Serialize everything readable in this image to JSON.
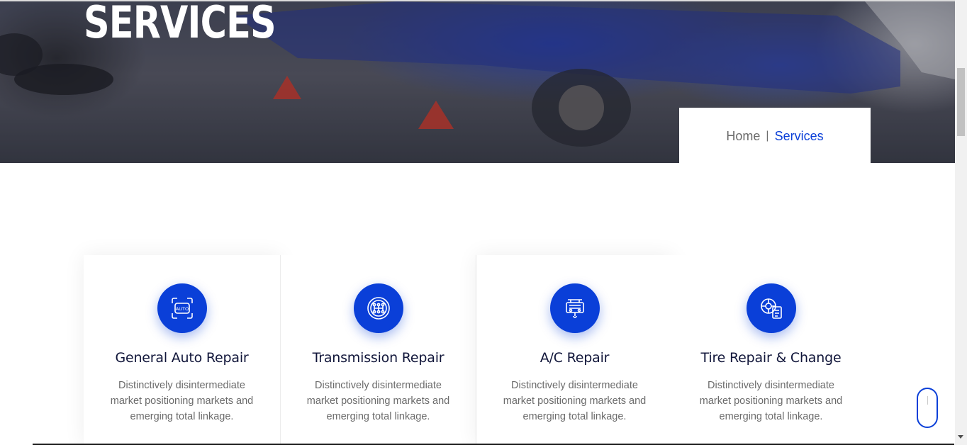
{
  "hero": {
    "title": "SERVICES"
  },
  "breadcrumb": {
    "home": "Home",
    "separator": "|",
    "current": "Services"
  },
  "services": [
    {
      "icon": "auto-scan-icon",
      "title": "General Auto Repair",
      "description": "Distinctively disintermediate market positioning markets and emerging total linkage."
    },
    {
      "icon": "gear-shift-icon",
      "title": "Transmission Repair",
      "description": "Distinctively disintermediate market positioning markets and emerging total linkage."
    },
    {
      "icon": "engine-hoist-icon",
      "title": "A/C Repair",
      "description": "Distinctively disintermediate market positioning markets and emerging total linkage."
    },
    {
      "icon": "wheel-diagnostic-icon",
      "title": "Tire Repair & Change",
      "description": "Distinctively disintermediate market positioning markets and emerging total linkage."
    }
  ],
  "colors": {
    "accent": "#0a3fd8",
    "heading": "#11163a",
    "body_text": "#6b6b6b"
  }
}
